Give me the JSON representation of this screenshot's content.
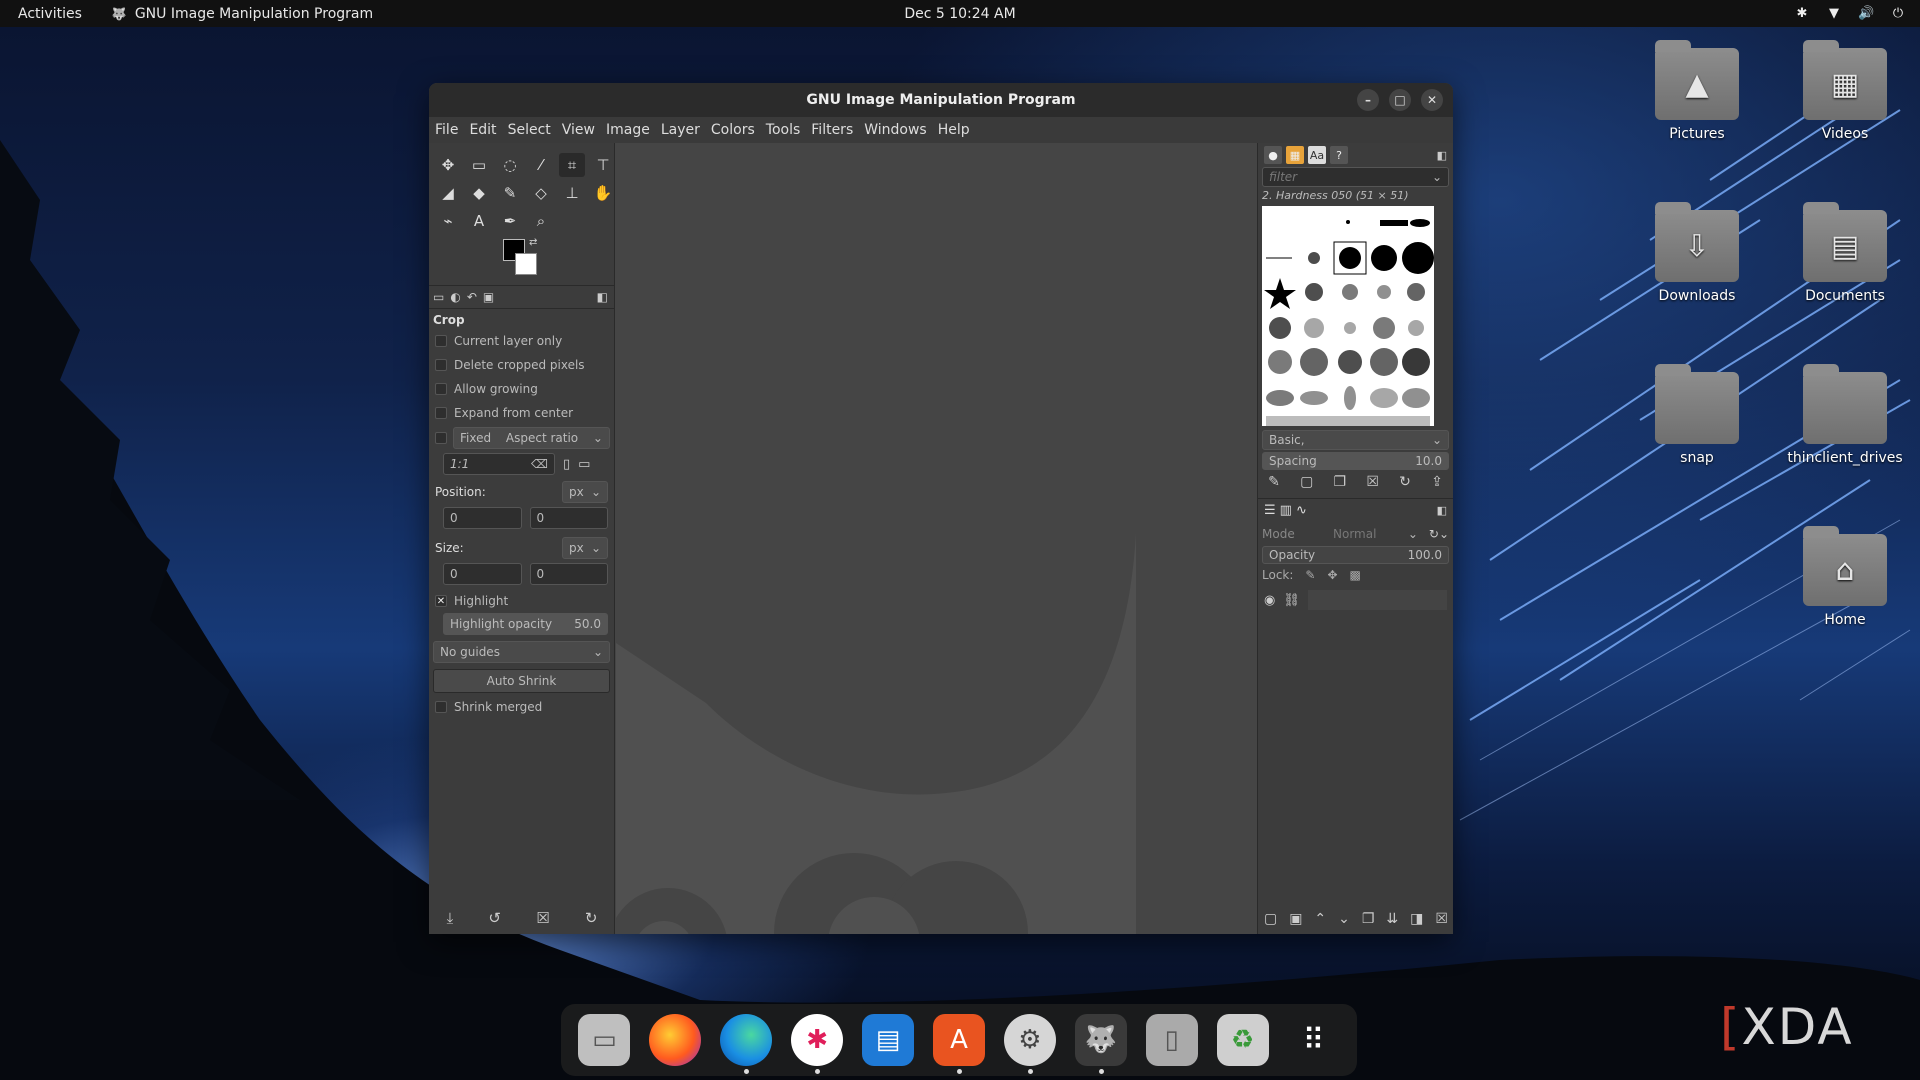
{
  "topbar": {
    "activities": "Activities",
    "app_name": "GNU Image Manipulation Program",
    "clock": "Dec 5  10:24 AM"
  },
  "desktop": {
    "pictures": "Pictures",
    "videos": "Videos",
    "downloads": "Downloads",
    "documents": "Documents",
    "snap": "snap",
    "thinclient": "thinclient_drives",
    "home": "Home"
  },
  "window": {
    "title": "GNU Image Manipulation Program",
    "menu": [
      "File",
      "Edit",
      "Select",
      "View",
      "Image",
      "Layer",
      "Colors",
      "Tools",
      "Filters",
      "Windows",
      "Help"
    ]
  },
  "tool_options": {
    "title": "Crop",
    "current_layer_only": "Current layer only",
    "delete_cropped": "Delete cropped pixels",
    "allow_growing": "Allow growing",
    "expand_center": "Expand from center",
    "fixed": "Fixed",
    "aspect_ratio": "Aspect ratio",
    "ratio_value": "1:1",
    "position_label": "Position:",
    "position_unit": "px",
    "pos_x": "0",
    "pos_y": "0",
    "size_label": "Size:",
    "size_unit": "px",
    "size_w": "0",
    "size_h": "0",
    "highlight": "Highlight",
    "highlight_opacity_label": "Highlight opacity",
    "highlight_opacity_value": "50.0",
    "guides": "No guides",
    "auto_shrink": "Auto Shrink",
    "shrink_merged": "Shrink merged"
  },
  "brushes": {
    "filter_placeholder": "filter",
    "current_brush": "2. Hardness 050 (51 × 51)",
    "preset": "Basic,",
    "spacing_label": "Spacing",
    "spacing_value": "10.0"
  },
  "layers": {
    "mode_label": "Mode",
    "mode_value": "Normal",
    "opacity_label": "Opacity",
    "opacity_value": "100.0",
    "lock_label": "Lock:"
  },
  "watermark": "XDA"
}
